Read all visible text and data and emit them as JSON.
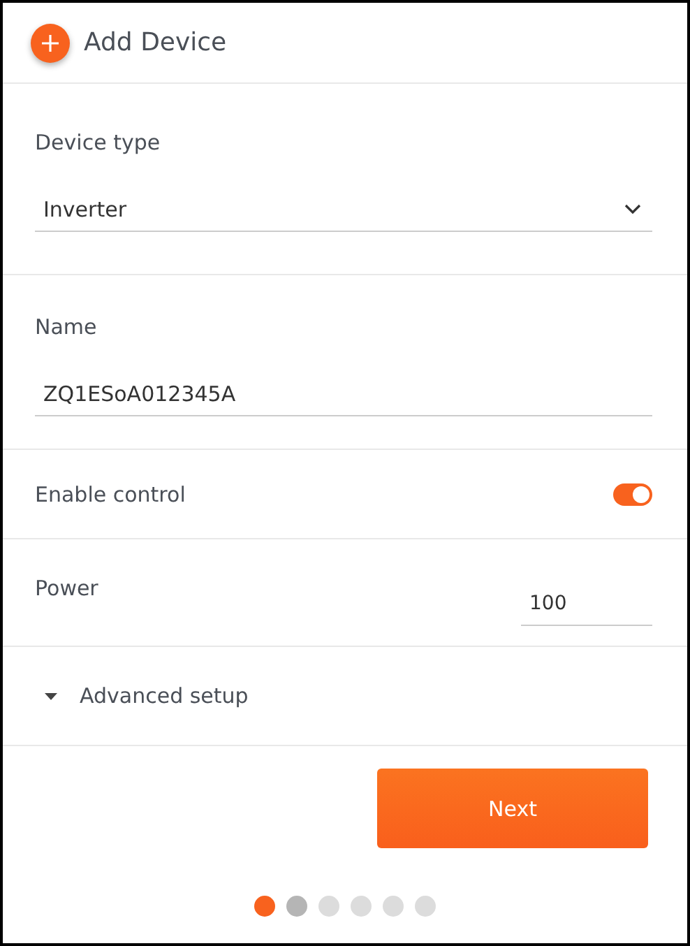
{
  "header": {
    "title": "Add Device"
  },
  "device_type": {
    "label": "Device type",
    "value": "Inverter"
  },
  "name": {
    "label": "Name",
    "value": "ZQ1ESoA012345A"
  },
  "enable_control": {
    "label": "Enable control",
    "on": true
  },
  "power": {
    "label": "Power",
    "value": "100"
  },
  "advanced": {
    "label": "Advanced setup",
    "expanded": false
  },
  "next_button": {
    "label": "Next"
  },
  "steps": [
    {
      "selected": true,
      "completed": false
    },
    {
      "selected": false,
      "completed": true
    },
    {
      "selected": false,
      "completed": false
    },
    {
      "selected": false,
      "completed": false
    },
    {
      "selected": false,
      "completed": false
    },
    {
      "selected": false,
      "completed": false
    }
  ]
}
